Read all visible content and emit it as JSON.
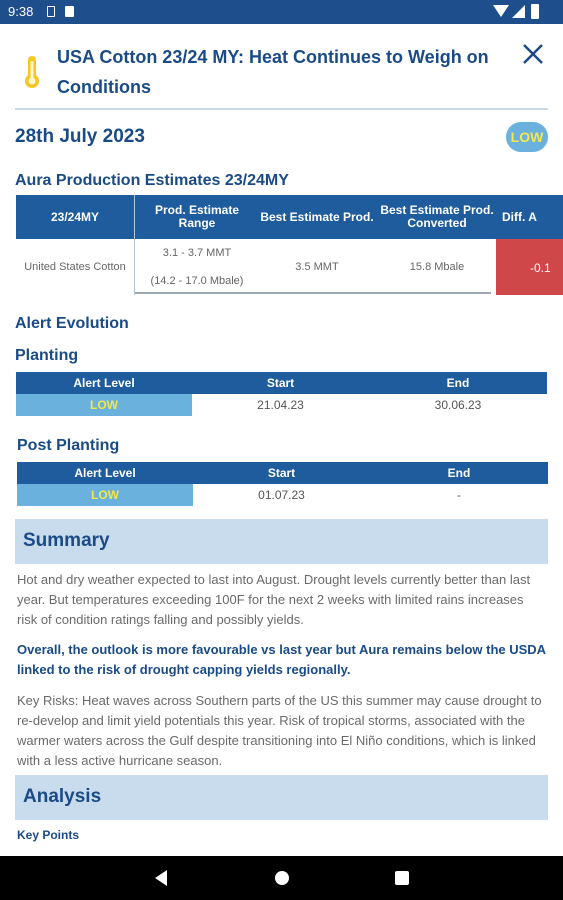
{
  "status_bar": {
    "time": "9:38"
  },
  "header": {
    "title": "USA Cotton 23/24 MY: Heat Continues to Weigh on Conditions",
    "close_icon": "close-icon",
    "alert_icon": "thermometer-icon"
  },
  "report": {
    "date": "28th July 2023",
    "risk_badge": "LOW"
  },
  "production": {
    "heading": "Aura Production Estimates 23/24MY",
    "columns": [
      "23/24MY",
      "Prod. Estimate Range",
      "Best Estimate Prod.",
      "Best Estimate Prod. Converted",
      "Diff. A"
    ],
    "row": {
      "country": "United States Cotton",
      "range_mmt": "3.1 - 3.7 MMT",
      "range_mbale": "(14.2 - 17.0 Mbale)",
      "best": "3.5 MMT",
      "best_converted": "15.8 Mbale",
      "diff": "-0.1"
    }
  },
  "alert_evolution": {
    "heading": "Alert Evolution",
    "columns": [
      "Alert Level",
      "Start",
      "End"
    ],
    "planting": {
      "heading": "Planting",
      "level": "LOW",
      "start": "21.04.23",
      "end": "30.06.23"
    },
    "post_planting": {
      "heading": "Post Planting",
      "level": "LOW",
      "start": "01.07.23",
      "end": "-"
    }
  },
  "summary": {
    "heading": "Summary",
    "p1": "Hot and dry weather expected to last into August. Drought levels currently better than last year. But temperatures exceeding 100F for the next 2 weeks with limited rains increases risk of condition ratings falling and possibly yields.",
    "p2": "Overall, the outlook is more favourable vs last year but Aura remains below the USDA linked to the risk of drought capping yields regionally.",
    "p3": "Key Risks: Heat waves across Southern parts of the US this summer may cause drought to re-develop and limit yield potentials this year. Risk of tropical storms, associated with the warmer waters across the Gulf despite transitioning into El Niño conditions, which is linked with a less active hurricane season."
  },
  "analysis": {
    "heading": "Analysis",
    "key_points": "Key Points"
  },
  "colors": {
    "primary": "#1e5c9e",
    "header_blue": "#1a4b87",
    "low": "#6bb1de",
    "low_text": "#f3e84a",
    "negative": "#d0474a",
    "band": "#c9dcee"
  }
}
